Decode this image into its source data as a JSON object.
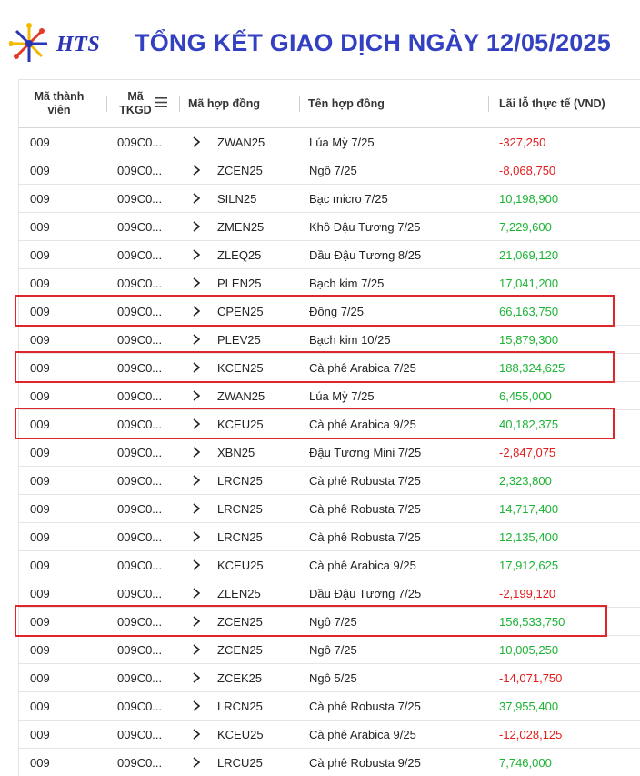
{
  "header": {
    "logo_text": "HTS",
    "title": "TỔNG KẾT GIAO DỊCH NGÀY 12/05/2025"
  },
  "table": {
    "columns": {
      "member_line1": "Mã thành",
      "member_line2": "viên",
      "tkgd_line1": "Mã",
      "tkgd_line2": "TKGD",
      "contract_code": "Mã hợp đồng",
      "contract_name": "Tên hợp đồng",
      "pnl": "Lãi lỗ thực tế (VND)"
    },
    "rows": [
      {
        "member": "009",
        "account": "009C0...",
        "code": "ZWAN25",
        "name": "Lúa Mỳ 7/25",
        "pnl": "-327,250",
        "status": "neg",
        "highlighted": false
      },
      {
        "member": "009",
        "account": "009C0...",
        "code": "ZCEN25",
        "name": "Ngô 7/25",
        "pnl": "-8,068,750",
        "status": "neg",
        "highlighted": false
      },
      {
        "member": "009",
        "account": "009C0...",
        "code": "SILN25",
        "name": "Bạc micro 7/25",
        "pnl": "10,198,900",
        "status": "pos",
        "highlighted": false
      },
      {
        "member": "009",
        "account": "009C0...",
        "code": "ZMEN25",
        "name": "Khô Đậu Tương 7/25",
        "pnl": "7,229,600",
        "status": "pos",
        "highlighted": false
      },
      {
        "member": "009",
        "account": "009C0...",
        "code": "ZLEQ25",
        "name": "Dầu Đậu Tương 8/25",
        "pnl": "21,069,120",
        "status": "pos",
        "highlighted": false
      },
      {
        "member": "009",
        "account": "009C0...",
        "code": "PLEN25",
        "name": "Bạch kim 7/25",
        "pnl": "17,041,200",
        "status": "pos",
        "highlighted": false
      },
      {
        "member": "009",
        "account": "009C0...",
        "code": "CPEN25",
        "name": "Đồng 7/25",
        "pnl": "66,163,750",
        "status": "pos",
        "highlighted": true
      },
      {
        "member": "009",
        "account": "009C0...",
        "code": "PLEV25",
        "name": "Bạch kim 10/25",
        "pnl": "15,879,300",
        "status": "pos",
        "highlighted": false
      },
      {
        "member": "009",
        "account": "009C0...",
        "code": "KCEN25",
        "name": "Cà phê Arabica 7/25",
        "pnl": "188,324,625",
        "status": "pos",
        "highlighted": true
      },
      {
        "member": "009",
        "account": "009C0...",
        "code": "ZWAN25",
        "name": "Lúa Mỳ 7/25",
        "pnl": "6,455,000",
        "status": "pos",
        "highlighted": false
      },
      {
        "member": "009",
        "account": "009C0...",
        "code": "KCEU25",
        "name": "Cà phê Arabica 9/25",
        "pnl": "40,182,375",
        "status": "pos",
        "highlighted": true
      },
      {
        "member": "009",
        "account": "009C0...",
        "code": "XBN25",
        "name": "Đậu Tương Mini 7/25",
        "pnl": "-2,847,075",
        "status": "neg",
        "highlighted": false
      },
      {
        "member": "009",
        "account": "009C0...",
        "code": "LRCN25",
        "name": "Cà phê Robusta 7/25",
        "pnl": "2,323,800",
        "status": "pos",
        "highlighted": false
      },
      {
        "member": "009",
        "account": "009C0...",
        "code": "LRCN25",
        "name": "Cà phê Robusta 7/25",
        "pnl": "14,717,400",
        "status": "pos",
        "highlighted": false
      },
      {
        "member": "009",
        "account": "009C0...",
        "code": "LRCN25",
        "name": "Cà phê Robusta 7/25",
        "pnl": "12,135,400",
        "status": "pos",
        "highlighted": false
      },
      {
        "member": "009",
        "account": "009C0...",
        "code": "KCEU25",
        "name": "Cà phê Arabica 9/25",
        "pnl": "17,912,625",
        "status": "pos",
        "highlighted": false
      },
      {
        "member": "009",
        "account": "009C0...",
        "code": "ZLEN25",
        "name": "Dầu Đậu Tương 7/25",
        "pnl": "-2,199,120",
        "status": "neg",
        "highlighted": false
      },
      {
        "member": "009",
        "account": "009C0...",
        "code": "ZCEN25",
        "name": "Ngô 7/25",
        "pnl": "156,533,750",
        "status": "pos",
        "highlighted": true
      },
      {
        "member": "009",
        "account": "009C0...",
        "code": "ZCEN25",
        "name": "Ngô 7/25",
        "pnl": "10,005,250",
        "status": "pos",
        "highlighted": false
      },
      {
        "member": "009",
        "account": "009C0...",
        "code": "ZCEK25",
        "name": "Ngô 5/25",
        "pnl": "-14,071,750",
        "status": "neg",
        "highlighted": false
      },
      {
        "member": "009",
        "account": "009C0...",
        "code": "LRCN25",
        "name": "Cà phê Robusta 7/25",
        "pnl": "37,955,400",
        "status": "pos",
        "highlighted": false
      },
      {
        "member": "009",
        "account": "009C0...",
        "code": "KCEU25",
        "name": "Cà phê Arabica 9/25",
        "pnl": "-12,028,125",
        "status": "neg",
        "highlighted": false
      },
      {
        "member": "009",
        "account": "009C0...",
        "code": "LRCU25",
        "name": "Cà phê Robusta 9/25",
        "pnl": "7,746,000",
        "status": "pos",
        "highlighted": false
      }
    ]
  },
  "colors": {
    "title": "#3340c2",
    "positive": "#1db335",
    "negative": "#e31b1b",
    "highlight_box": "#e0262b"
  }
}
